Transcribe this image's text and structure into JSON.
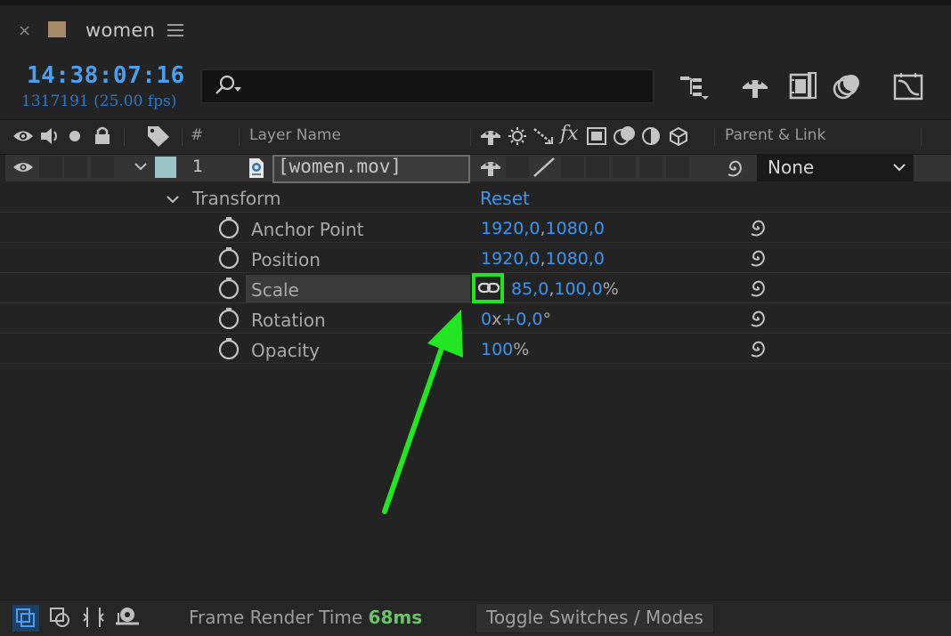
{
  "tab": {
    "close": "×",
    "title": "women",
    "menu_icon": "hamburger-menu-icon"
  },
  "timecode": {
    "current": "14:38:07:16",
    "frames": "1317191 (25.00 fps)"
  },
  "search": {
    "placeholder": ""
  },
  "header": {
    "number": "#",
    "layer_name": "Layer Name",
    "fx": "fx",
    "parent_link": "Parent & Link"
  },
  "layer": {
    "number": "1",
    "name": "[women.mov]",
    "parent": "None",
    "label_color": "#9cc6c5"
  },
  "transform": {
    "label": "Transform",
    "reset": "Reset",
    "properties": [
      {
        "name": "Anchor Point",
        "v1": "1920,0",
        "sep": ",",
        "v2": "1080,0",
        "unit": ""
      },
      {
        "name": "Position",
        "v1": "1920,0",
        "sep": ",",
        "v2": "1080,0",
        "unit": ""
      },
      {
        "name": "Scale",
        "v1": "85,0",
        "sep": ",",
        "v2": "100,0",
        "unit": "%"
      },
      {
        "name": "Rotation",
        "v1": "0",
        "sep": "x",
        "v2": "+0,0",
        "unit": "°"
      },
      {
        "name": "Opacity",
        "v1": "100",
        "sep": "",
        "v2": "",
        "unit": "%"
      }
    ]
  },
  "bottom": {
    "render_label": "Frame Render Time",
    "render_value": "68ms",
    "toggle": "Toggle Switches / Modes"
  },
  "colors": {
    "accent": "#3f95ee",
    "highlight": "#1fe61f",
    "arrow": "#22e622"
  }
}
